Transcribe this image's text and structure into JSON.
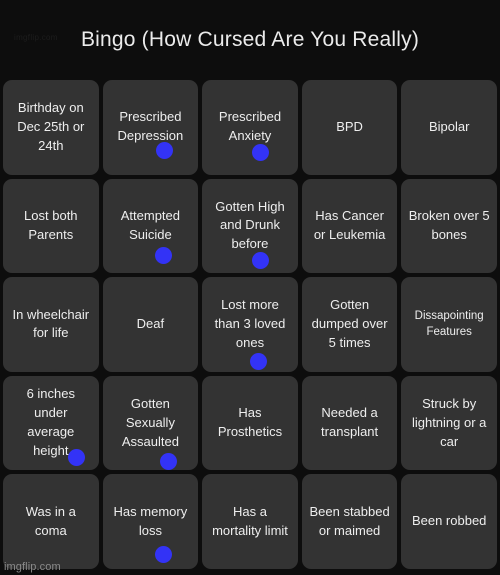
{
  "header": {
    "title": "Bingo (How Cursed Are You Really)",
    "corner_watermark": "imgflip.com"
  },
  "footer": {
    "watermark": "imgflip.com"
  },
  "marker": {
    "color": "#3333f6",
    "shape": "filled-circle"
  },
  "theme": {
    "page_background": "#0d0d0d",
    "cell_background": "#333333",
    "text_color": "#eeeeee",
    "title_color": "#ebebeb"
  },
  "grid": {
    "columns": 5,
    "rows": 5,
    "cells": [
      {
        "label": "Birthday on Dec 25th or 24th",
        "marked": false,
        "small": false,
        "dot_x": "",
        "dot_y": ""
      },
      {
        "label": "Prescribed Depression",
        "marked": true,
        "small": false,
        "dot_x": "56%",
        "dot_y": "66%"
      },
      {
        "label": "Prescribed Anxiety",
        "marked": true,
        "small": false,
        "dot_x": "52%",
        "dot_y": "68%"
      },
      {
        "label": "BPD",
        "marked": false,
        "small": false,
        "dot_x": "",
        "dot_y": ""
      },
      {
        "label": "Bipolar",
        "marked": false,
        "small": false,
        "dot_x": "",
        "dot_y": ""
      },
      {
        "label": "Lost both Parents",
        "marked": false,
        "small": false,
        "dot_x": "",
        "dot_y": ""
      },
      {
        "label": "Attempted Suicide",
        "marked": true,
        "small": false,
        "dot_x": "55%",
        "dot_y": "72%"
      },
      {
        "label": "Gotten High and Drunk before",
        "marked": true,
        "small": false,
        "dot_x": "52%",
        "dot_y": "78%"
      },
      {
        "label": "Has Cancer or Leukemia",
        "marked": false,
        "small": false,
        "dot_x": "",
        "dot_y": ""
      },
      {
        "label": "Broken over 5 bones",
        "marked": false,
        "small": false,
        "dot_x": "",
        "dot_y": ""
      },
      {
        "label": "In wheelchair for life",
        "marked": false,
        "small": false,
        "dot_x": "",
        "dot_y": ""
      },
      {
        "label": "Deaf",
        "marked": false,
        "small": false,
        "dot_x": "",
        "dot_y": ""
      },
      {
        "label": "Lost more than 3 loved ones",
        "marked": true,
        "small": false,
        "dot_x": "50%",
        "dot_y": "80%"
      },
      {
        "label": "Gotten dumped over 5 times",
        "marked": false,
        "small": false,
        "dot_x": "",
        "dot_y": ""
      },
      {
        "label": "Dissapointing Features",
        "marked": false,
        "small": true,
        "dot_x": "",
        "dot_y": ""
      },
      {
        "label": "6 inches under average height",
        "marked": true,
        "small": false,
        "dot_x": "68%",
        "dot_y": "77%"
      },
      {
        "label": "Gotten Sexually Assaulted",
        "marked": true,
        "small": false,
        "dot_x": "60%",
        "dot_y": "82%"
      },
      {
        "label": "Has Prosthetics",
        "marked": false,
        "small": false,
        "dot_x": "",
        "dot_y": ""
      },
      {
        "label": "Needed a transplant",
        "marked": false,
        "small": false,
        "dot_x": "",
        "dot_y": ""
      },
      {
        "label": "Struck by lightning or a car",
        "marked": false,
        "small": false,
        "dot_x": "",
        "dot_y": ""
      },
      {
        "label": "Was in a coma",
        "marked": false,
        "small": false,
        "dot_x": "",
        "dot_y": ""
      },
      {
        "label": "Has memory loss",
        "marked": true,
        "small": false,
        "dot_x": "55%",
        "dot_y": "76%"
      },
      {
        "label": "Has a mortality limit",
        "marked": false,
        "small": false,
        "dot_x": "",
        "dot_y": ""
      },
      {
        "label": "Been stabbed or maimed",
        "marked": false,
        "small": false,
        "dot_x": "",
        "dot_y": ""
      },
      {
        "label": "Been robbed",
        "marked": false,
        "small": false,
        "dot_x": "",
        "dot_y": ""
      }
    ]
  }
}
